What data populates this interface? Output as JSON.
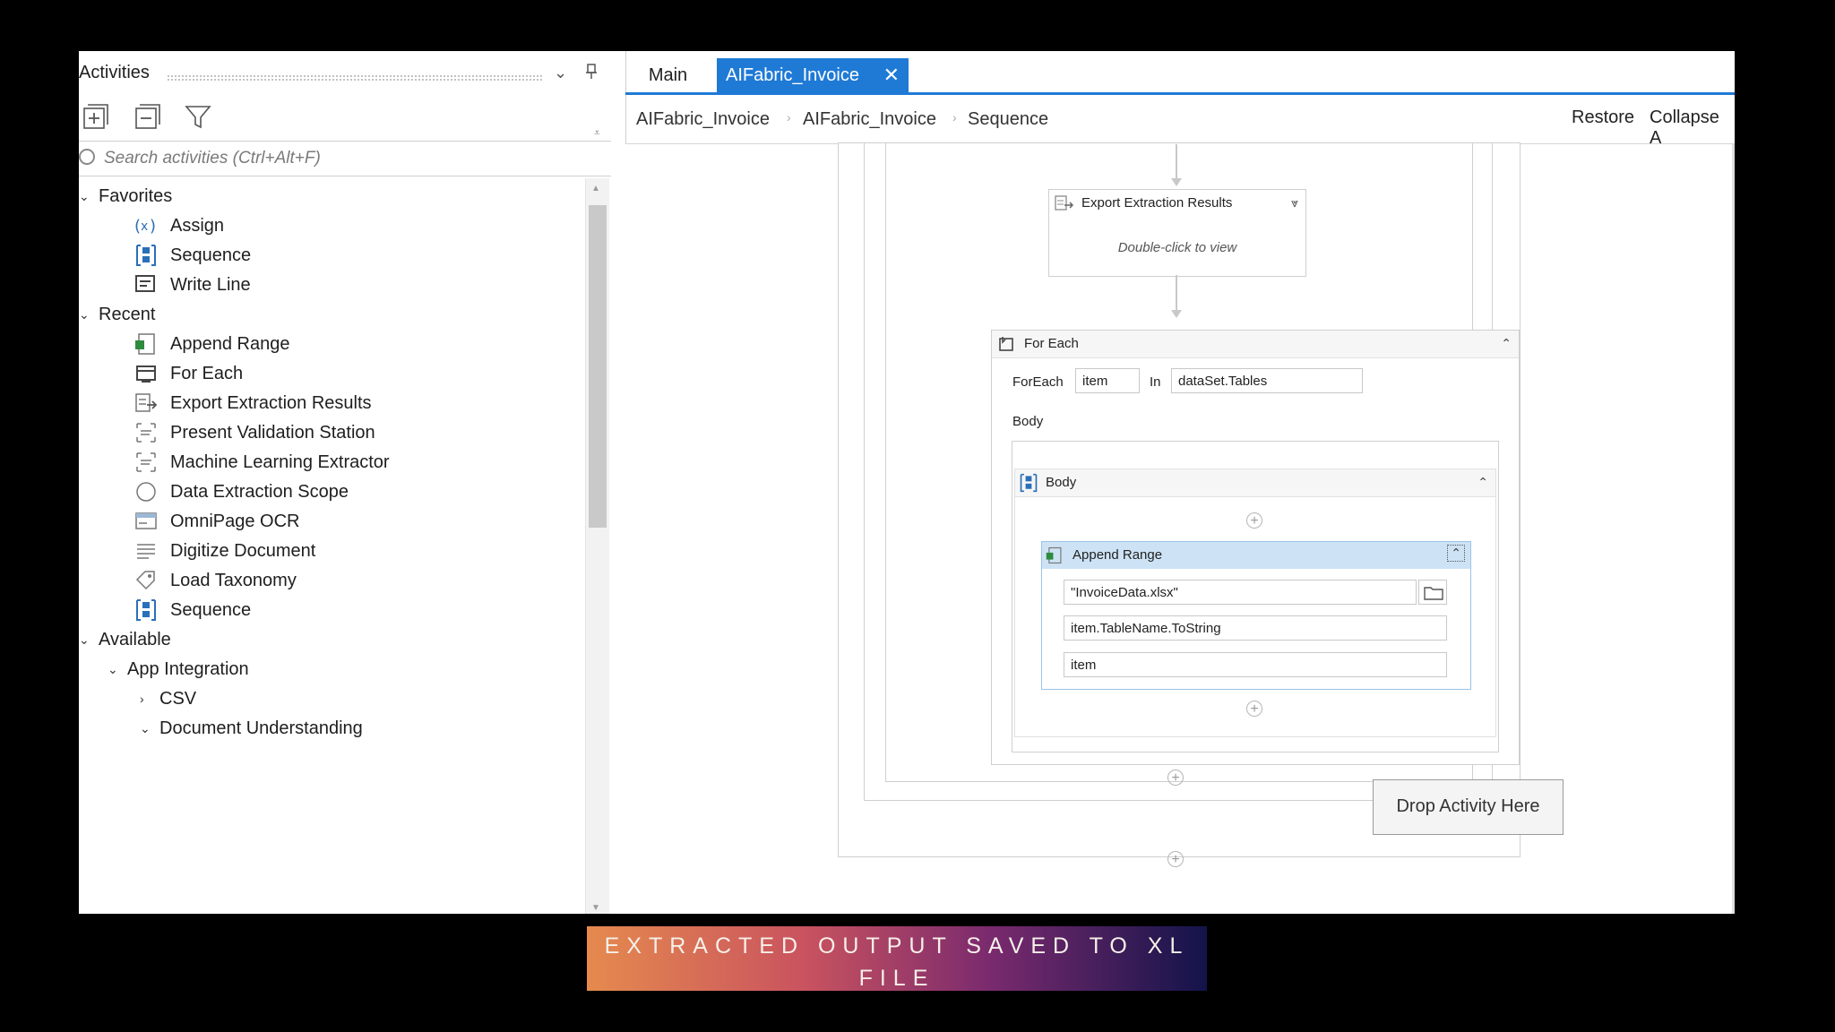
{
  "activities_panel": {
    "title": "Activities",
    "search_placeholder": "Search activities (Ctrl+Alt+F)",
    "groups": {
      "favorites": {
        "label": "Favorites",
        "items": [
          "Assign",
          "Sequence",
          "Write Line"
        ]
      },
      "recent": {
        "label": "Recent",
        "items": [
          "Append Range",
          "For Each",
          "Export Extraction Results",
          "Present Validation Station",
          "Machine Learning Extractor",
          "Data Extraction Scope",
          "OmniPage OCR",
          "Digitize Document",
          "Load Taxonomy",
          "Sequence"
        ]
      },
      "available": {
        "label": "Available",
        "app_integration": "App Integration",
        "csv": "CSV",
        "document_understanding": "Document Understanding"
      }
    }
  },
  "tabs": {
    "main": "Main",
    "active": "AIFabric_Invoice"
  },
  "breadcrumb": {
    "items": [
      "AIFabric_Invoice",
      "AIFabric_Invoice",
      "Sequence"
    ],
    "restore": "Restore",
    "collapse": "Collapse A"
  },
  "workflow": {
    "export": {
      "title": "Export Extraction Results",
      "hint": "Double-click to view"
    },
    "foreach": {
      "title": "For Each",
      "foreach_label": "ForEach",
      "item": "item",
      "in_label": "In",
      "collection": "dataSet.Tables",
      "body_label": "Body"
    },
    "body": {
      "title": "Body"
    },
    "append": {
      "title": "Append Range",
      "workbook": "\"InvoiceData.xlsx\"",
      "sheet": "item.TableName.ToString",
      "datatable": "item"
    },
    "drop_here": "Drop Activity Here"
  },
  "caption": "EXTRACTED OUTPUT SAVED TO XL FILE",
  "colors": {
    "accent": "#1f7ad6",
    "append_header": "#cde3f5"
  }
}
